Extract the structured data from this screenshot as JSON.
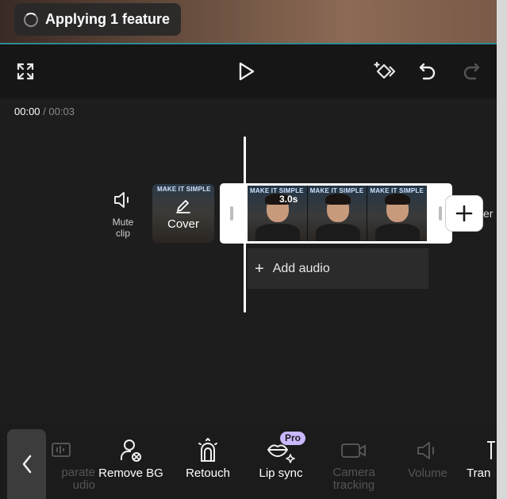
{
  "toast": {
    "text": "Applying 1 feature"
  },
  "timecode": {
    "current": "00:00",
    "total": "/ 00:03"
  },
  "track": {
    "mute_label": "Mute\nclip",
    "cover_label": "Cover",
    "thumbnail_banner": "MAKE IT SIMPLE",
    "clip_duration": "3.0s",
    "add_audio_label": "Add audio",
    "next_peek_text": "er"
  },
  "toolbar": {
    "items": [
      {
        "label": "Separate audio",
        "visible_text": "parate\nudio",
        "state": "disabled"
      },
      {
        "label": "Remove BG",
        "state": "enabled"
      },
      {
        "label": "Retouch",
        "state": "enabled"
      },
      {
        "label": "Lip sync",
        "badge": "Pro",
        "state": "enabled"
      },
      {
        "label": "Camera tracking",
        "visible_text": "Camera\ntracking",
        "state": "disabled"
      },
      {
        "label": "Volume",
        "state": "disabled"
      },
      {
        "label": "Transition",
        "visible_text": "Tran",
        "state": "enabled"
      }
    ]
  },
  "icons": [
    "fullscreen-icon",
    "play-icon",
    "keyframe-icon",
    "undo-icon",
    "redo-icon",
    "speaker-icon",
    "pencil-icon",
    "plus-icon",
    "chevron-left-icon",
    "person-remove-bg-icon",
    "retouch-icon",
    "lips-sparkle-icon",
    "camera-icon",
    "volume-icon"
  ],
  "colors": {
    "background": "#1d1d1d",
    "accent_pro": "#c9b8ff",
    "divider": "#2d8a95"
  }
}
